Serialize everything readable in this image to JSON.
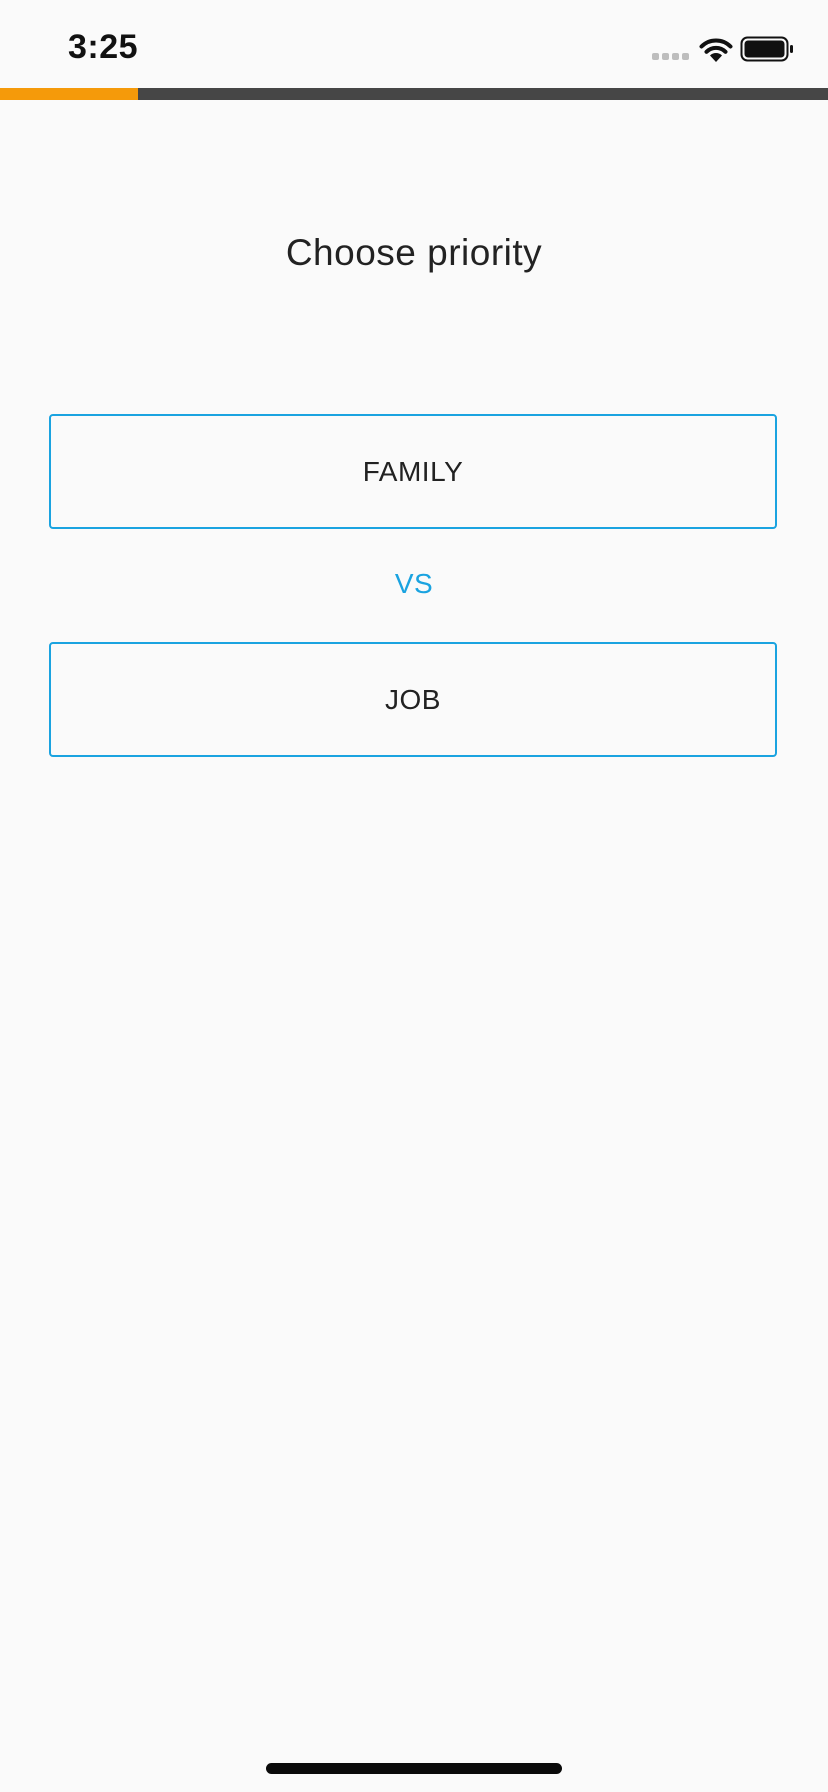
{
  "status_bar": {
    "time": "3:25",
    "signal_icon": "cellular-signal-icon",
    "wifi_icon": "wifi-icon",
    "battery_icon": "battery-icon"
  },
  "progress": {
    "fraction": 0.167,
    "fill_color": "#f59a0a",
    "track_color": "#464646"
  },
  "main": {
    "title": "Choose priority",
    "option_a": "FAMILY",
    "separator": "VS",
    "option_b": "JOB"
  },
  "colors": {
    "accent": "#1aa3e0",
    "background": "#fafafa",
    "text": "#222222"
  }
}
